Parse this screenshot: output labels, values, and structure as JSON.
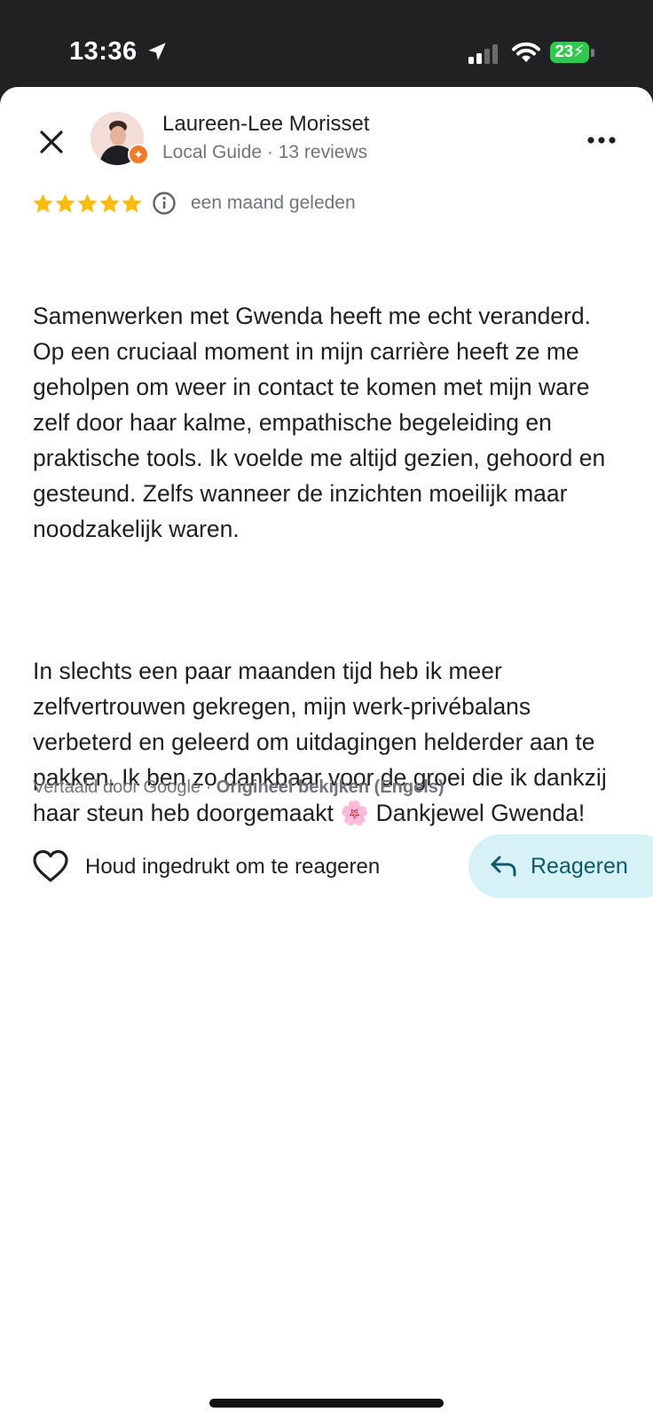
{
  "status_bar": {
    "time": "13:36",
    "battery_level": "23",
    "icons": [
      "location-arrow-icon",
      "cellular-signal-icon",
      "wifi-icon",
      "battery-charging-icon"
    ]
  },
  "header": {
    "reviewer_name": "Laureen-Lee Morisset",
    "reviewer_meta": "Local Guide · 13 reviews",
    "icons": [
      "close-icon",
      "more-vert-icon",
      "local-guide-badge-icon"
    ]
  },
  "review": {
    "rating": 5,
    "rating_max": 5,
    "date": "een maand geleden",
    "star_color": "#fbbc04",
    "paragraphs": [
      "Samenwerken met Gwenda heeft me echt veranderd. Op een cruciaal moment in mijn carrière heeft ze me geholpen om weer in contact te komen met mijn ware zelf door haar kalme, empathische begeleiding en praktische tools. Ik voelde me altijd gezien, gehoord en gesteund. Zelfs wanneer de inzichten moeilijk maar noodzakelijk waren.",
      "In slechts een paar maanden tijd heb ik meer zelfvertrouwen gekregen, mijn werk-privébalans verbeterd en geleerd om uitdagingen helderder aan te pakken. Ik ben zo dankbaar voor de groei die ik dankzij haar steun heb doorgemaakt 🌸 Dankjewel Gwenda!"
    ],
    "translated_by": "Vertaald door Google · ",
    "view_original": "Origineel bekijken (Engels)"
  },
  "actions": {
    "hold_label": "Houd ingedrukt om te reageren",
    "reply_label": "Reageren",
    "reply_bg": "#d6f2f7",
    "reply_color": "#0e5a6a"
  }
}
